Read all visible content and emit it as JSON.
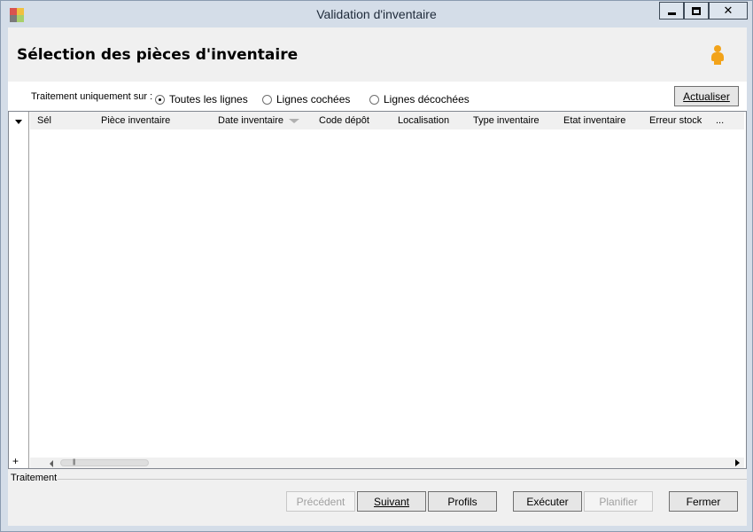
{
  "window": {
    "title": "Validation d'inventaire"
  },
  "header": {
    "title": "Sélection des pièces d'inventaire",
    "user_icon": "user-icon"
  },
  "filter": {
    "label": "Traitement uniquement sur :",
    "options": [
      {
        "label": "Toutes les lignes",
        "checked": true
      },
      {
        "label": "Lignes cochées",
        "checked": false
      },
      {
        "label": "Lignes décochées",
        "checked": false
      }
    ],
    "refresh_button": "Actualiser"
  },
  "grid": {
    "columns": [
      "Sél",
      "Pièce inventaire",
      "Date inventaire",
      "Code dépôt",
      "Localisation",
      "Type inventaire",
      "Etat inventaire",
      "Erreur stock",
      "..."
    ],
    "sorted_column": "Date inventaire",
    "rows": [],
    "add_row_label": "+"
  },
  "footer": {
    "section_label": "Traitement",
    "buttons": {
      "previous": "Précédent",
      "next": "Suivant",
      "profiles": "Profils",
      "execute": "Exécuter",
      "schedule": "Planifier",
      "close": "Fermer"
    }
  },
  "colors": {
    "titlebar": "#d4dde8",
    "client_bg": "#f0f0f0",
    "user_icon": "#f2a31a"
  }
}
